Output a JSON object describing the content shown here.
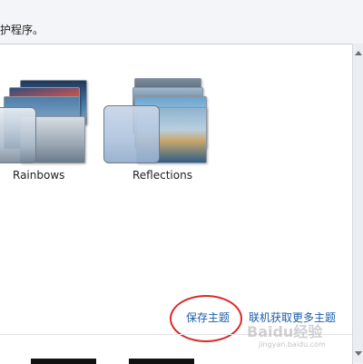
{
  "header": {
    "text": "护程序。"
  },
  "themes": [
    {
      "label": "Rainbows"
    },
    {
      "label": "Reflections"
    }
  ],
  "links": {
    "save_theme": "保存主题",
    "get_more_themes": "联机获取更多主题"
  },
  "watermark": {
    "logo_text": "Baidu经验",
    "url": "jingyan.baidu.com"
  },
  "colors": {
    "link": "#1a5ca8",
    "annotation": "#d92a2a"
  }
}
